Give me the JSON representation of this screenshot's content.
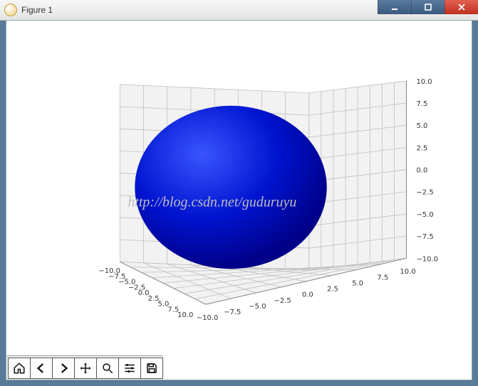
{
  "window": {
    "title": "Figure 1",
    "controls": {
      "minimize": "minimize",
      "maximize": "maximize",
      "close": "close"
    }
  },
  "toolbar": {
    "home": "Home",
    "back": "Back",
    "forward": "Forward",
    "pan": "Pan",
    "zoom": "Zoom",
    "configure": "Configure subplots",
    "save": "Save"
  },
  "watermark": "http://blog.csdn.net/guduruyu",
  "chart_data": {
    "type": "surface3d",
    "title": "",
    "subtitle": "",
    "x_axis": {
      "label": "",
      "ticks": [
        10.0,
        7.5,
        5.0,
        2.5,
        0.0,
        -2.5,
        -5.0,
        -7.5,
        -10.0
      ],
      "range": [
        -10.0,
        10.0
      ]
    },
    "y_axis": {
      "label": "",
      "ticks": [
        10.0,
        7.5,
        5.0,
        2.5,
        0.0,
        -2.5,
        -5.0,
        -7.5,
        -10.0
      ],
      "range": [
        -10.0,
        10.0
      ]
    },
    "z_axis": {
      "label": "",
      "ticks": [
        10.0,
        7.5,
        5.0,
        2.5,
        0.0,
        -2.5,
        -5.0,
        -7.5,
        -10.0
      ],
      "range": [
        -10.0,
        10.0
      ]
    },
    "grid": true,
    "legend": null,
    "series": [
      {
        "name": "sphere",
        "kind": "sphere",
        "center": [
          0.0,
          0.0,
          0.0
        ],
        "radius": 10.0,
        "color": "#0000cc"
      }
    ],
    "x_ticklabels": [
      "10.0",
      "7.5",
      "5.0",
      "2.5",
      "0.0",
      "−2.5",
      "−5.0",
      "−7.5",
      "−10.0"
    ],
    "y_ticklabels": [
      "10.0",
      "7.5",
      "5.0",
      "2.5",
      "0.0",
      "−2.5",
      "−5.0",
      "−7.5",
      "−10.0"
    ],
    "z_ticklabels": [
      "10.0",
      "7.5",
      "5.0",
      "2.5",
      "0.0",
      "−2.5",
      "−5.0",
      "−7.5",
      "−10.0"
    ]
  }
}
